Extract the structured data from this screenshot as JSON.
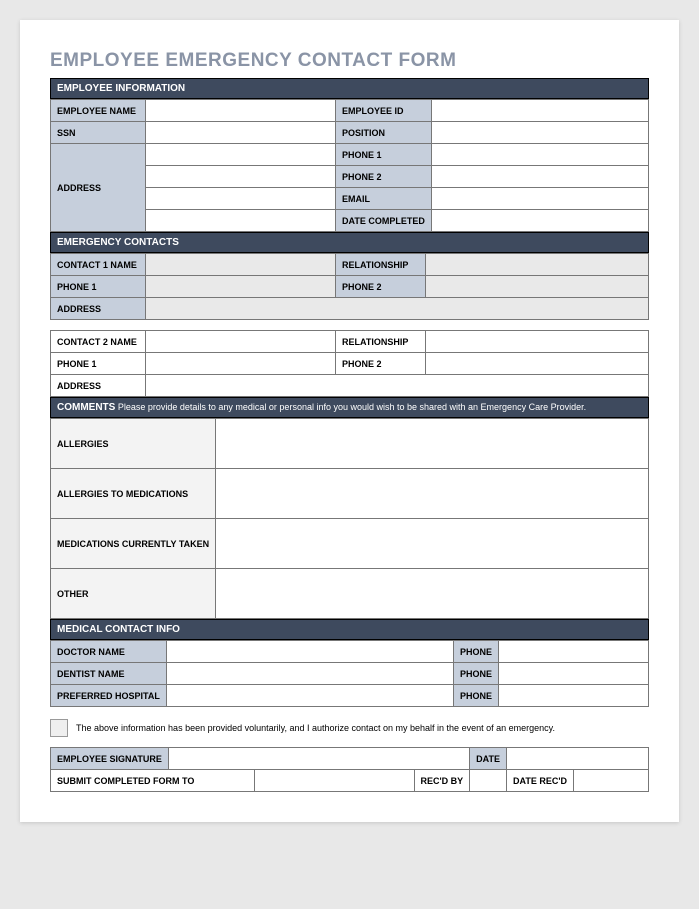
{
  "title": "EMPLOYEE EMERGENCY CONTACT FORM",
  "sections": {
    "employeeInfo": {
      "header": "EMPLOYEE INFORMATION",
      "labels": {
        "employeeName": "EMPLOYEE NAME",
        "employeeId": "EMPLOYEE ID",
        "ssn": "SSN",
        "position": "POSITION",
        "address": "ADDRESS",
        "phone1": "PHONE 1",
        "phone2": "PHONE 2",
        "email": "EMAIL",
        "dateCompleted": "DATE COMPLETED"
      }
    },
    "emergencyContacts": {
      "header": "EMERGENCY CONTACTS",
      "labels": {
        "contact1Name": "CONTACT 1 NAME",
        "relationship": "RELATIONSHIP",
        "phone1": "PHONE 1",
        "phone2": "PHONE 2",
        "address": "ADDRESS",
        "contact2Name": "CONTACT 2 NAME"
      }
    },
    "comments": {
      "headerBold": "COMMENTS",
      "headerText": " Please provide details to any medical or personal info you would wish to be shared with an Emergency Care Provider.",
      "labels": {
        "allergies": "ALLERGIES",
        "allergiesMeds": "ALLERGIES TO MEDICATIONS",
        "medsTaken": "MEDICATIONS CURRENTLY TAKEN",
        "other": "OTHER"
      }
    },
    "medicalContact": {
      "header": "MEDICAL CONTACT INFO",
      "labels": {
        "doctorName": "DOCTOR NAME",
        "phone": "PHONE",
        "dentistName": "DENTIST NAME",
        "preferredHospital": "PREFERRED HOSPITAL"
      }
    },
    "disclaimer": "The above information has been provided voluntarily, and I authorize contact on my behalf in the event of an emergency.",
    "signature": {
      "labels": {
        "employeeSignature": "EMPLOYEE SIGNATURE",
        "date": "DATE",
        "submitTo": "SUBMIT COMPLETED FORM TO",
        "recdBy": "REC'D BY",
        "dateRecd": "DATE REC'D"
      }
    }
  }
}
